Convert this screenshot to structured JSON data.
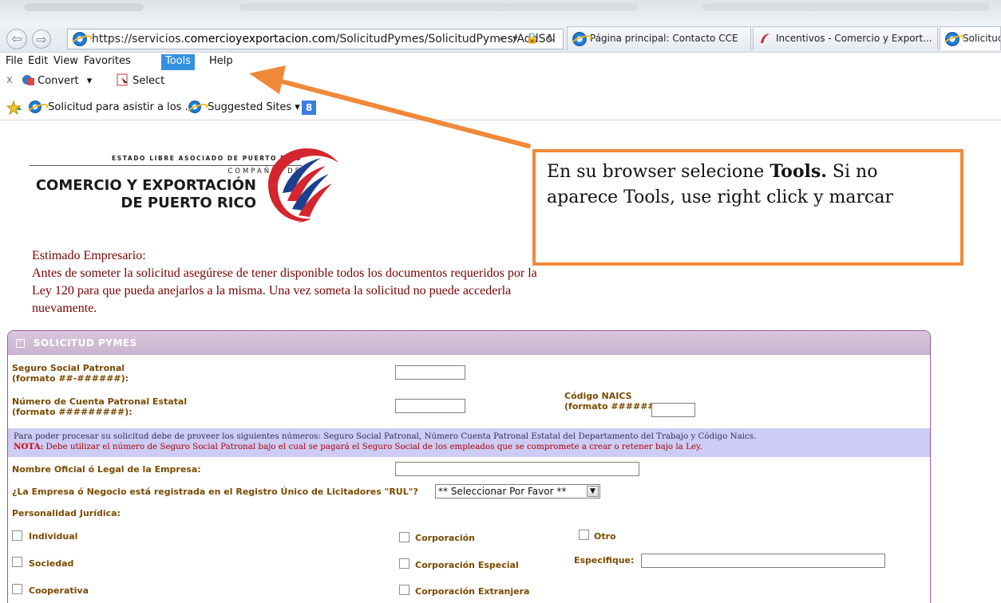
{
  "browser": {
    "url_prefix": "https://servicios.",
    "url_domain": "comercioyexportacion.com",
    "url_path": "/SolicitudPymes/SolicitudPymes/AddSol",
    "address_icons": "⌕ ▾ 🔒 ↻",
    "tabs": [
      {
        "label": "Página principal: Contacto CCE"
      },
      {
        "label": "Incentivos - Comercio y Export..."
      },
      {
        "label": "Solicitud"
      }
    ],
    "menu": [
      "File",
      "Edit",
      "View",
      "Favorites",
      "Tools",
      "Help"
    ],
    "command_bar": {
      "close": "x",
      "convert": "Convert",
      "dropdown": "▾",
      "select": "Select"
    },
    "favorites": [
      {
        "label": "Solicitud para asistir a los ..."
      },
      {
        "label": "Suggested Sites ▾"
      }
    ],
    "google_badge": "8"
  },
  "logo": {
    "top": "ESTADO LIBRE ASOCIADO DE PUERTO RICO",
    "sub": "COMPAÑÍA DE",
    "line1": "COMERCIO Y EXPORTACIÓN",
    "line2": "DE PUERTO RICO"
  },
  "callout": {
    "part1": "En su browser selecione ",
    "bold": "Tools.",
    "part2": " Si no aparece Tools, use right click y marcar"
  },
  "intro": {
    "greeting": "Estimado Empresario:",
    "body": "Antes de someter la solicitud asegúrese de tener disponible todos los documentos requeridos por la Ley 120 para que pueda anejarlos a la misma. Una vez someta la solicitud no puede accederla nuevamente."
  },
  "form": {
    "title": "SOLICITUD PYMES",
    "ss_label_1": "Seguro Social Patronal",
    "ss_label_2": "(formato ##-######):",
    "cuenta_label_1": "Número de Cuenta Patronal Estatal",
    "cuenta_label_2": "(formato #########):",
    "naics_label_1": "Código NAICS",
    "naics_label_2": "(formato ######):",
    "notice_line": "Para poder procesar su solicitud debe de proveer los siguientes números: Seguro Social Patronal, Número Cuenta Patronal Estatal del Departamento del Trabajo y Código Naics.",
    "nota_label": "NOTA:",
    "nota_text": " Debe utilizar el número de Seguro Social Patronal bajo el cual se pagará el Seguro Social de los empleados que se compromete a crear o retener bajo la Ley.",
    "nombre_label": "Nombre Oficial ó Legal de la Empresa:",
    "rul_label": "¿La Empresa ó Negocio está registrada en el Registro Único de Licitadores \"RUL\"?",
    "rul_select": "** Seleccionar Por Favor **",
    "personalidad_label": "Personalidad Jurídica:",
    "options": {
      "individual": "Individual",
      "corporacion": "Corporación",
      "otro": "Otro",
      "sociedad": "Sociedad",
      "corp_especial": "Corporación Especial",
      "especifique": "Especifique:",
      "cooperativa": "Cooperativa",
      "corp_extranjera": "Corporación Extranjera"
    }
  },
  "colors": {
    "callout_border": "#f0893a",
    "panel_header": "#c9b3cf",
    "intro_text": "#7a0000",
    "notice_bg": "#ccccf5"
  }
}
